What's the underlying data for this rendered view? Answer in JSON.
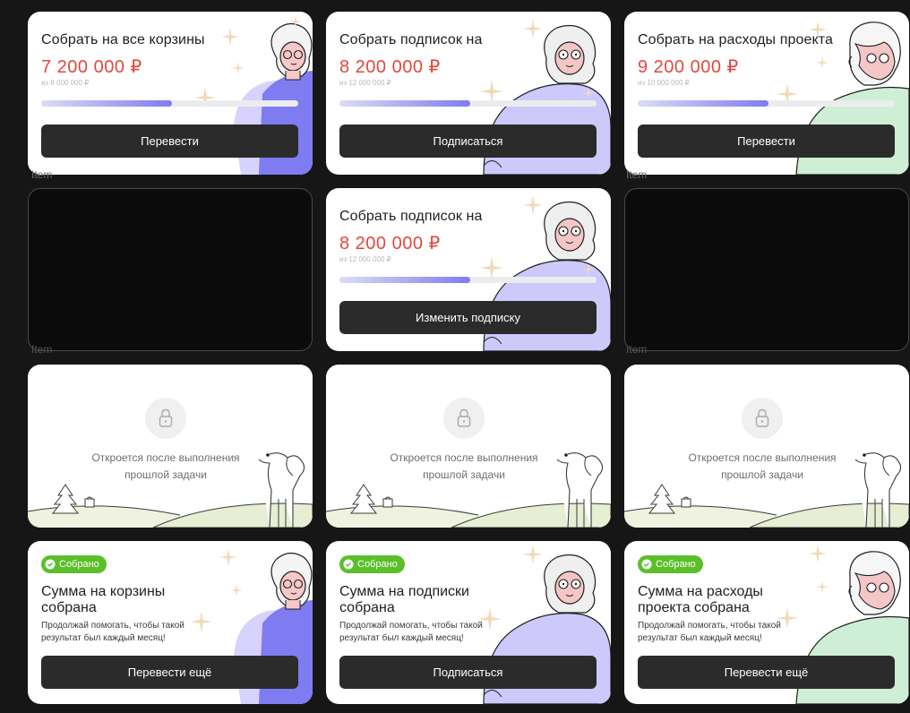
{
  "colors": {
    "accent_red": "#e2483d",
    "progress_purple": "#7f7bf0",
    "success_green": "#5cbf2a",
    "button_dark": "#2b2b2b"
  },
  "row1": [
    {
      "title": "Собрать на все корзины",
      "amount": "7 200 000 ₽",
      "goal": "из 8 000 000 ₽",
      "progress": 0.51,
      "button": "Перевести",
      "figure": "woman-purple"
    },
    {
      "title": "Собрать подписок на",
      "amount": "8 200 000 ₽",
      "goal": "из 12 000 000 ₽",
      "progress": 0.51,
      "button": "Подписаться",
      "figure": "woman-lavender"
    },
    {
      "title": "Собрать на расходы проекта",
      "amount": "9 200 000 ₽",
      "goal": "из 10 000 000 ₽",
      "progress": 0.51,
      "button": "Перевести",
      "figure": "man-green"
    }
  ],
  "row2": [
    {
      "title": "Собрать подписок на",
      "amount": "8 200 000 ₽",
      "goal": "из 12 000 000 ₽",
      "progress": 0.51,
      "button": "Изменить подписку",
      "figure": "woman-lavender"
    }
  ],
  "item_label": "Item",
  "locked": {
    "text_line1": "Откроется после выполнения",
    "text_line2": "прошлой задачи",
    "icon": "lock-icon"
  },
  "done_badge": "Собрано",
  "done_description": "Продолжай помогать, чтобы такой результат был каждый месяц!",
  "row4": [
    {
      "title": "Сумма на корзины собрана",
      "button": "Перевести ещё"
    },
    {
      "title": "Сумма на подписки собрана",
      "button": "Подписаться"
    },
    {
      "title": "Сумма на расходы проекта собрана",
      "button": "Перевести ещё"
    }
  ]
}
